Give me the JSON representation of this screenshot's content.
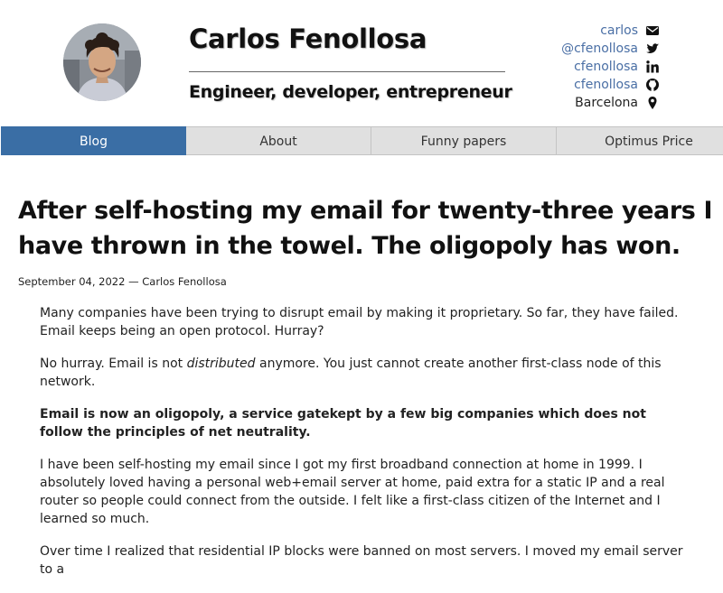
{
  "site": {
    "name": "Carlos Fenollosa",
    "tagline": "Engineer, developer, entrepreneur"
  },
  "contacts": [
    {
      "label": "carlos",
      "icon": "envelope-icon",
      "kind": "link"
    },
    {
      "label": "@cfenollosa",
      "icon": "twitter-icon",
      "kind": "link"
    },
    {
      "label": "cfenollosa",
      "icon": "linkedin-icon",
      "kind": "link"
    },
    {
      "label": "cfenollosa",
      "icon": "github-icon",
      "kind": "link"
    },
    {
      "label": "Barcelona",
      "icon": "map-marker-icon",
      "kind": "text"
    }
  ],
  "nav": {
    "items": [
      {
        "label": "Blog",
        "active": true
      },
      {
        "label": "About",
        "active": false
      },
      {
        "label": "Funny papers",
        "active": false
      },
      {
        "label": "Optimus Price",
        "active": false
      }
    ]
  },
  "article": {
    "title": "After self-hosting my email for twenty-three years I have thrown in the towel. The oligopoly has won.",
    "byline": "September 04, 2022 — Carlos Fenollosa",
    "p1": "Many companies have been trying to disrupt email by making it proprietary. So far, they have failed. Email keeps being an open protocol. Hurray?",
    "p2_before": "No hurray. Email is not ",
    "p2_em": "distributed",
    "p2_after": " anymore. You just cannot create another first-class node of this network.",
    "p3": "Email is now an oligopoly, a service gatekept by a few big companies which does not follow the principles of net neutrality.",
    "p4": "I have been self-hosting my email since I got my first broadband connection at home in 1999. I absolutely loved having a personal web+email server at home, paid extra for a static IP and a real router so people could connect from the outside. I felt like a first-class citizen of the Internet and I learned so much.",
    "p5": "Over time I realized that residential IP blocks were banned on most servers. I moved my email server to a"
  },
  "colors": {
    "accent": "#3a6ea5",
    "link": "#4a6fa5",
    "nav_bg": "#e0e0e0"
  }
}
